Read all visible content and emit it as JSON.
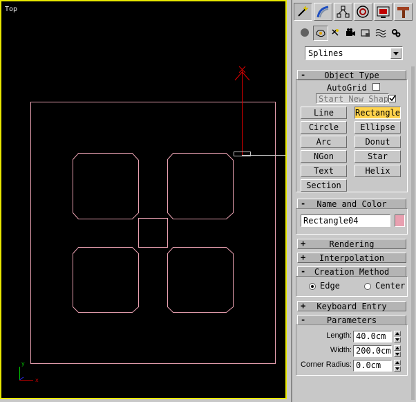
{
  "viewport": {
    "label": "Top"
  },
  "panel": {
    "tabs": [
      "create-icon",
      "modify-icon",
      "hierarchy-icon",
      "motion-icon",
      "display-icon",
      "utilities-icon"
    ],
    "subtabs": [
      "geometry-icon",
      "shapes-icon",
      "lights-icon",
      "cameras-icon",
      "helpers-icon",
      "space-warps-icon",
      "systems-icon"
    ],
    "category": "Splines",
    "object_type": {
      "title": "Object Type",
      "autogrid": "AutoGrid",
      "start_new_shape": "Start New Shape",
      "buttons": [
        "Line",
        "Rectangle",
        "Circle",
        "Ellipse",
        "Arc",
        "Donut",
        "NGon",
        "Star",
        "Text",
        "Helix",
        "Section"
      ],
      "active": "Rectangle"
    },
    "name_color": {
      "title": "Name and Color",
      "name": "Rectangle04",
      "color": "#e8a0b0"
    },
    "rendering": {
      "title": "Rendering"
    },
    "interpolation": {
      "title": "Interpolation"
    },
    "creation_method": {
      "title": "Creation Method",
      "edge": "Edge",
      "center": "Center"
    },
    "keyboard_entry": {
      "title": "Keyboard Entry"
    },
    "parameters": {
      "title": "Parameters",
      "length_label": "Length:",
      "length": "40.0cm",
      "width_label": "Width:",
      "width": "200.0cm",
      "corner_label": "Corner Radius:",
      "corner": "0.0cm"
    },
    "signs": {
      "minus": "-",
      "plus": "+"
    }
  }
}
